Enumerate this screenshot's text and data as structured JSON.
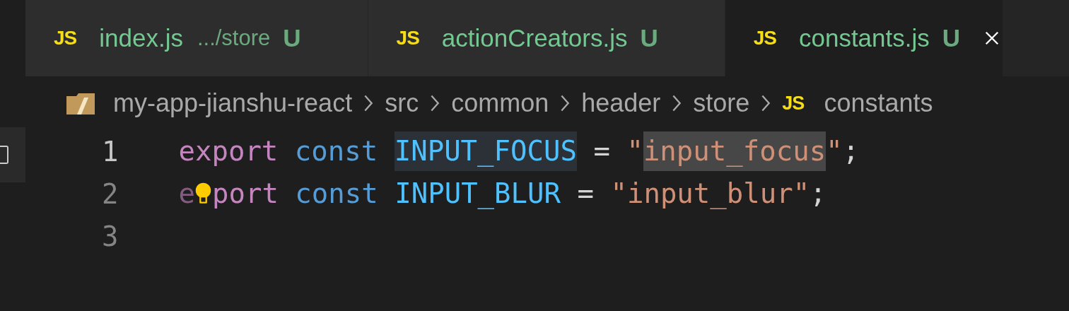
{
  "tabs": [
    {
      "icon": "JS",
      "name": "index.js",
      "description": ".../store",
      "status": "U",
      "selected": false
    },
    {
      "icon": "JS",
      "name": "actionCreators.js",
      "status": "U",
      "selected": false
    },
    {
      "icon": "JS",
      "name": "constants.js",
      "status": "U",
      "selected": true
    }
  ],
  "breadcrumb": {
    "folders": [
      "my-app-jianshu-react",
      "src",
      "common",
      "header",
      "store"
    ],
    "file_icon": "JS",
    "file": "constants"
  },
  "code_lines": [
    {
      "number": "1",
      "lightbulb": false,
      "tokens": [
        {
          "text": "export",
          "kind": "keyword",
          "joined": false,
          "highlighted": false,
          "selected": false,
          "dimmed": false
        },
        {
          "text": "const",
          "kind": "storage",
          "joined": false,
          "highlighted": false,
          "selected": false,
          "dimmed": false
        },
        {
          "text": "INPUT_FOCUS",
          "kind": "constant",
          "joined": false,
          "highlighted": true,
          "selected": false,
          "dimmed": false
        },
        {
          "text": "=",
          "kind": "plain",
          "joined": false,
          "highlighted": false,
          "selected": false,
          "dimmed": false
        },
        {
          "text": "\"",
          "kind": "string",
          "joined": false,
          "highlighted": false,
          "selected": false,
          "dimmed": false
        },
        {
          "text": "input_focus",
          "kind": "string",
          "joined": true,
          "highlighted": false,
          "selected": true,
          "dimmed": false
        },
        {
          "text": "\"",
          "kind": "string",
          "joined": true,
          "highlighted": false,
          "selected": false,
          "dimmed": false
        },
        {
          "text": ";",
          "kind": "plain",
          "joined": true,
          "highlighted": false,
          "selected": false,
          "dimmed": false
        }
      ]
    },
    {
      "number": "2",
      "lightbulb": true,
      "tokens": [
        {
          "text": "e",
          "kind": "keyword",
          "joined": false,
          "highlighted": false,
          "selected": false,
          "dimmed": true
        },
        {
          "text": "port",
          "kind": "keyword",
          "joined": true,
          "highlighted": false,
          "selected": false,
          "dimmed": false
        },
        {
          "text": "const",
          "kind": "storage",
          "joined": false,
          "highlighted": false,
          "selected": false,
          "dimmed": false
        },
        {
          "text": "INPUT_BLUR",
          "kind": "constant",
          "joined": false,
          "highlighted": false,
          "selected": false,
          "dimmed": false
        },
        {
          "text": "=",
          "kind": "plain",
          "joined": false,
          "highlighted": false,
          "selected": false,
          "dimmed": false
        },
        {
          "text": "\"input_blur\"",
          "kind": "string",
          "joined": false,
          "highlighted": false,
          "selected": false,
          "dimmed": false
        },
        {
          "text": ";",
          "kind": "plain",
          "joined": true,
          "highlighted": false,
          "selected": false,
          "dimmed": false
        }
      ]
    },
    {
      "number": "3",
      "lightbulb": false
    }
  ]
}
